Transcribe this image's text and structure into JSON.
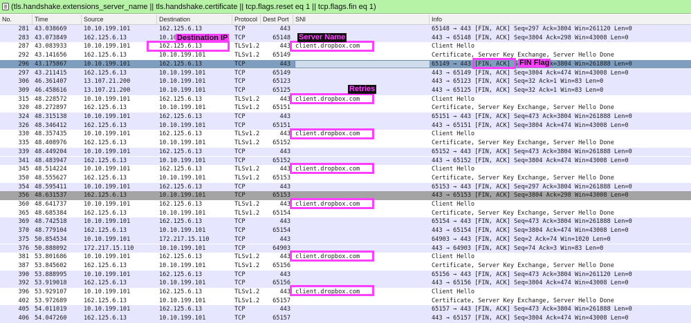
{
  "filter": {
    "text": "(tls.handshake.extensions_server_name || tls.handshake.certificate || tcp.flags.reset eq 1 || tcp.flags.fin eq 1)"
  },
  "columns": {
    "no": "No.",
    "time": "Time",
    "source": "Source",
    "destination": "Destination",
    "protocol": "Protocol",
    "dport": "Dest Port",
    "sni": "SNI",
    "info": "Info"
  },
  "annotations": {
    "destination_ip": "Destination IP",
    "server_name": "Server Name",
    "fin_flag": "FIN Flag",
    "retries": "Retries"
  },
  "colors": {
    "filter_bg": "#b7f3a7",
    "row_lavender": "#e7e6ff",
    "row_gray": "#a4a4a4",
    "row_selected": "#7f9dbf",
    "highlight": "#ff3fff"
  },
  "packets": [
    {
      "no": "281",
      "time": "43.038669",
      "src": "10.10.199.101",
      "dst": "162.125.6.13",
      "proto": "TCP",
      "port": "443",
      "sni": "",
      "info": "65148 → 443 [FIN, ACK] Seq=297 Ack=3804 Win=261120 Len=0",
      "bg": "lav"
    },
    {
      "no": "283",
      "time": "43.073849",
      "src": "162.125.6.13",
      "dst": "10.10",
      "proto": "TCP",
      "port": "65148",
      "sni": "",
      "info": "443 → 65148 [FIN, ACK] Seq=3804 Ack=298 Win=43008 Len=0",
      "bg": "lav"
    },
    {
      "no": "287",
      "time": "43.083933",
      "src": "10.10.199.101",
      "dst": "162.125.6.13",
      "proto": "TLSv1.2",
      "port": "443",
      "sni": "client.dropbox.com",
      "info": "Client Hello",
      "bg": "white"
    },
    {
      "no": "292",
      "time": "43.141656",
      "src": "162.125.6.13",
      "dst": "10.10.199.101",
      "proto": "TLSv1.2",
      "port": "65149",
      "sni": "",
      "info": "Certificate, Server Key Exchange, Server Hello Done",
      "bg": "white"
    },
    {
      "no": "296",
      "time": "43.175867",
      "src": "10.10.199.101",
      "dst": "162.125.6.13",
      "proto": "TCP",
      "port": "443",
      "sni": "",
      "info": "65149 → 443 [FIN, ACK] Seq=297 Ack=3804 Win=261888 Len=0",
      "bg": "sel"
    },
    {
      "no": "297",
      "time": "43.211415",
      "src": "162.125.6.13",
      "dst": "10.10.199.101",
      "proto": "TCP",
      "port": "65149",
      "sni": "",
      "info": "443 → 65149 [FIN, ACK] Seq=3804 Ack=474 Win=43008 Len=0",
      "bg": "lav"
    },
    {
      "no": "306",
      "time": "46.361407",
      "src": "13.107.21.200",
      "dst": "10.10.199.101",
      "proto": "TCP",
      "port": "65123",
      "sni": "",
      "info": "443 → 65123 [FIN, ACK] Seq=32 Ack=1 Win=83 Len=0",
      "bg": "lav"
    },
    {
      "no": "309",
      "time": "46.458616",
      "src": "13.107.21.200",
      "dst": "10.10.199.101",
      "proto": "TCP",
      "port": "65125",
      "sni": "",
      "info": "443 → 65125 [FIN, ACK] Seq=32 Ack=1 Win=83 Len=0",
      "bg": "lav"
    },
    {
      "no": "315",
      "time": "48.228572",
      "src": "10.10.199.101",
      "dst": "162.125.6.13",
      "proto": "TLSv1.2",
      "port": "443",
      "sni": "client.dropbox.com",
      "info": "Client Hello",
      "bg": "white"
    },
    {
      "no": "320",
      "time": "48.272897",
      "src": "162.125.6.13",
      "dst": "10.10.199.101",
      "proto": "TLSv1.2",
      "port": "65151",
      "sni": "",
      "info": "Certificate, Server Key Exchange, Server Hello Done",
      "bg": "white"
    },
    {
      "no": "324",
      "time": "48.315138",
      "src": "10.10.199.101",
      "dst": "162.125.6.13",
      "proto": "TCP",
      "port": "443",
      "sni": "",
      "info": "65151 → 443 [FIN, ACK] Seq=473 Ack=3804 Win=261888 Len=0",
      "bg": "lav"
    },
    {
      "no": "326",
      "time": "48.346412",
      "src": "162.125.6.13",
      "dst": "10.10.199.101",
      "proto": "TCP",
      "port": "65151",
      "sni": "",
      "info": "443 → 65151 [FIN, ACK] Seq=3804 Ack=474 Win=43008 Len=0",
      "bg": "lav"
    },
    {
      "no": "330",
      "time": "48.357435",
      "src": "10.10.199.101",
      "dst": "162.125.6.13",
      "proto": "TLSv1.2",
      "port": "443",
      "sni": "client.dropbox.com",
      "info": "Client Hello",
      "bg": "white"
    },
    {
      "no": "335",
      "time": "48.408976",
      "src": "162.125.6.13",
      "dst": "10.10.199.101",
      "proto": "TLSv1.2",
      "port": "65152",
      "sni": "",
      "info": "Certificate, Server Key Exchange, Server Hello Done",
      "bg": "white"
    },
    {
      "no": "339",
      "time": "48.449204",
      "src": "10.10.199.101",
      "dst": "162.125.6.13",
      "proto": "TCP",
      "port": "443",
      "sni": "",
      "info": "65152 → 443 [FIN, ACK] Seq=473 Ack=3804 Win=261888 Len=0",
      "bg": "lav"
    },
    {
      "no": "341",
      "time": "48.483947",
      "src": "162.125.6.13",
      "dst": "10.10.199.101",
      "proto": "TCP",
      "port": "65152",
      "sni": "",
      "info": "443 → 65152 [FIN, ACK] Seq=3804 Ack=474 Win=43008 Len=0",
      "bg": "lav"
    },
    {
      "no": "345",
      "time": "48.514224",
      "src": "10.10.199.101",
      "dst": "162.125.6.13",
      "proto": "TLSv1.2",
      "port": "443",
      "sni": "client.dropbox.com",
      "info": "Client Hello",
      "bg": "white"
    },
    {
      "no": "350",
      "time": "48.555627",
      "src": "162.125.6.13",
      "dst": "10.10.199.101",
      "proto": "TLSv1.2",
      "port": "65153",
      "sni": "",
      "info": "Certificate, Server Key Exchange, Server Hello Done",
      "bg": "white"
    },
    {
      "no": "354",
      "time": "48.595411",
      "src": "10.10.199.101",
      "dst": "162.125.6.13",
      "proto": "TCP",
      "port": "443",
      "sni": "",
      "info": "65153 → 443 [FIN, ACK] Seq=297 Ack=3804 Win=261888 Len=0",
      "bg": "lav"
    },
    {
      "no": "356",
      "time": "48.631537",
      "src": "162.125.6.13",
      "dst": "10.10.199.101",
      "proto": "TCP",
      "port": "65153",
      "sni": "",
      "info": "443 → 65153 [FIN, ACK] Seq=3804 Ack=298 Win=43008 Len=0",
      "bg": "gray"
    },
    {
      "no": "360",
      "time": "48.641737",
      "src": "10.10.199.101",
      "dst": "162.125.6.13",
      "proto": "TLSv1.2",
      "port": "443",
      "sni": "client.dropbox.com",
      "info": "Client Hello",
      "bg": "white"
    },
    {
      "no": "365",
      "time": "48.685384",
      "src": "162.125.6.13",
      "dst": "10.10.199.101",
      "proto": "TLSv1.2",
      "port": "65154",
      "sni": "",
      "info": "Certificate, Server Key Exchange, Server Hello Done",
      "bg": "white"
    },
    {
      "no": "369",
      "time": "48.742518",
      "src": "10.10.199.101",
      "dst": "162.125.6.13",
      "proto": "TCP",
      "port": "443",
      "sni": "",
      "info": "65154 → 443 [FIN, ACK] Seq=473 Ack=3804 Win=261888 Len=0",
      "bg": "lav"
    },
    {
      "no": "370",
      "time": "48.779104",
      "src": "162.125.6.13",
      "dst": "10.10.199.101",
      "proto": "TCP",
      "port": "65154",
      "sni": "",
      "info": "443 → 65154 [FIN, ACK] Seq=3804 Ack=474 Win=43008 Len=0",
      "bg": "lav"
    },
    {
      "no": "375",
      "time": "50.854534",
      "src": "10.10.199.101",
      "dst": "172.217.15.110",
      "proto": "TCP",
      "port": "443",
      "sni": "",
      "info": "64903 → 443 [FIN, ACK] Seq=2 Ack=74 Win=1020 Len=0",
      "bg": "lav"
    },
    {
      "no": "376",
      "time": "50.888092",
      "src": "172.217.15.110",
      "dst": "10.10.199.101",
      "proto": "TCP",
      "port": "64903",
      "sni": "",
      "info": "443 → 64903 [FIN, ACK] Seq=74 Ack=3 Win=83 Len=0",
      "bg": "lav"
    },
    {
      "no": "381",
      "time": "53.801686",
      "src": "10.10.199.101",
      "dst": "162.125.6.13",
      "proto": "TLSv1.2",
      "port": "443",
      "sni": "client.dropbox.com",
      "info": "Client Hello",
      "bg": "white"
    },
    {
      "no": "387",
      "time": "53.845602",
      "src": "162.125.6.13",
      "dst": "10.10.199.101",
      "proto": "TLSv1.2",
      "port": "65156",
      "sni": "",
      "info": "Certificate, Server Key Exchange, Server Hello Done",
      "bg": "white"
    },
    {
      "no": "390",
      "time": "53.888995",
      "src": "10.10.199.101",
      "dst": "162.125.6.13",
      "proto": "TCP",
      "port": "443",
      "sni": "",
      "info": "65156 → 443 [FIN, ACK] Seq=473 Ack=3804 Win=261120 Len=0",
      "bg": "lav"
    },
    {
      "no": "392",
      "time": "53.919018",
      "src": "162.125.6.13",
      "dst": "10.10.199.101",
      "proto": "TCP",
      "port": "65156",
      "sni": "",
      "info": "443 → 65156 [FIN, ACK] Seq=3804 Ack=474 Win=43008 Len=0",
      "bg": "lav"
    },
    {
      "no": "396",
      "time": "53.929107",
      "src": "10.10.199.101",
      "dst": "162.125.6.13",
      "proto": "TLSv1.2",
      "port": "443",
      "sni": "client.dropbox.com",
      "info": "Client Hello",
      "bg": "white"
    },
    {
      "no": "402",
      "time": "53.972689",
      "src": "162.125.6.13",
      "dst": "10.10.199.101",
      "proto": "TLSv1.2",
      "port": "65157",
      "sni": "",
      "info": "Certificate, Server Key Exchange, Server Hello Done",
      "bg": "white"
    },
    {
      "no": "405",
      "time": "54.011019",
      "src": "10.10.199.101",
      "dst": "162.125.6.13",
      "proto": "TCP",
      "port": "443",
      "sni": "",
      "info": "65157 → 443 [FIN, ACK] Seq=473 Ack=3804 Win=261888 Len=0",
      "bg": "lav"
    },
    {
      "no": "406",
      "time": "54.047260",
      "src": "162.125.6.13",
      "dst": "10.10.199.101",
      "proto": "TCP",
      "port": "65157",
      "sni": "",
      "info": "443 → 65157 [FIN, ACK] Seq=3804 Ack=474 Win=43008 Len=0",
      "bg": "lav"
    }
  ]
}
